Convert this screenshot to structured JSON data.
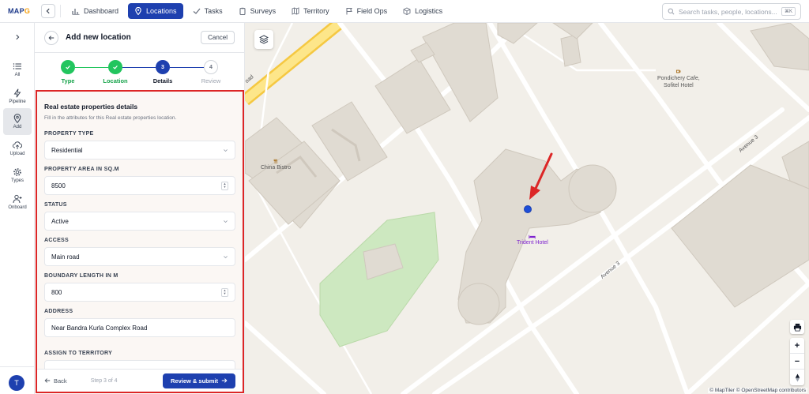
{
  "app": {
    "logo_main": "MAP",
    "logo_accent": "G"
  },
  "nav": [
    {
      "label": "Dashboard",
      "icon": "dashboard-icon"
    },
    {
      "label": "Locations",
      "icon": "location-pin-icon",
      "active": true
    },
    {
      "label": "Tasks",
      "icon": "check-icon"
    },
    {
      "label": "Surveys",
      "icon": "clipboard-icon"
    },
    {
      "label": "Territory",
      "icon": "map-icon"
    },
    {
      "label": "Field Ops",
      "icon": "flag-icon"
    },
    {
      "label": "Logistics",
      "icon": "box-icon"
    }
  ],
  "search": {
    "placeholder": "Search tasks, people, locations...",
    "shortcut": "⌘K"
  },
  "rail": [
    {
      "label": "All",
      "icon": "list-icon"
    },
    {
      "label": "Pipeline",
      "icon": "bolt-icon"
    },
    {
      "label": "Add",
      "icon": "location-pin-icon",
      "active": true
    },
    {
      "label": "Upload",
      "icon": "cloud-upload-icon"
    },
    {
      "label": "Types",
      "icon": "gear-icon"
    },
    {
      "label": "Onboard",
      "icon": "user-add-icon"
    }
  ],
  "user": {
    "initial": "T"
  },
  "panel": {
    "title": "Add new location",
    "cancel_label": "Cancel",
    "steps": [
      {
        "num": "1",
        "label": "Type",
        "state": "done"
      },
      {
        "num": "2",
        "label": "Location",
        "state": "done"
      },
      {
        "num": "3",
        "label": "Details",
        "state": "current"
      },
      {
        "num": "4",
        "label": "Review",
        "state": "todo"
      }
    ],
    "form": {
      "title": "Real estate properties details",
      "subtitle": "Fill in the attributes for this Real estate properties location.",
      "fields": [
        {
          "label": "PROPERTY TYPE",
          "value": "Residential",
          "kind": "select"
        },
        {
          "label": "PROPERTY AREA IN SQ.M",
          "value": "8500",
          "kind": "number"
        },
        {
          "label": "STATUS",
          "value": "Active",
          "kind": "select"
        },
        {
          "label": "ACCESS",
          "value": "Main road",
          "kind": "select"
        },
        {
          "label": "BOUNDARY LENGTH IN M",
          "value": "800",
          "kind": "number"
        },
        {
          "label": "ADDRESS",
          "value": "Near Bandra Kurla Complex Road",
          "kind": "text"
        },
        {
          "label": "ASSIGN TO TERRITORY",
          "value": "",
          "kind": "select"
        }
      ]
    },
    "footer": {
      "back_label": "Back",
      "step_text": "Step 3 of 4",
      "submit_label": "Review & submit"
    }
  },
  "map": {
    "labels": {
      "cafe": "Pondichery Cafe,\nSofitel Hotel",
      "bistro": "China Bistro",
      "hotel": "Trident Hotel",
      "avenue_top": "Avenue 3",
      "avenue_bottom": "Avenue 3",
      "road_fragment": "oad"
    },
    "attribution": "© MapTiler © OpenStreetMap contributors",
    "controls": {
      "print": "print-icon",
      "zoom_in": "+",
      "zoom_out": "−",
      "compass": "compass-icon"
    },
    "colors": {
      "marker": "#1d4ed8",
      "arrow": "#dc2626",
      "highlight": "#dc2626",
      "active_nav": "#1e40af"
    }
  }
}
